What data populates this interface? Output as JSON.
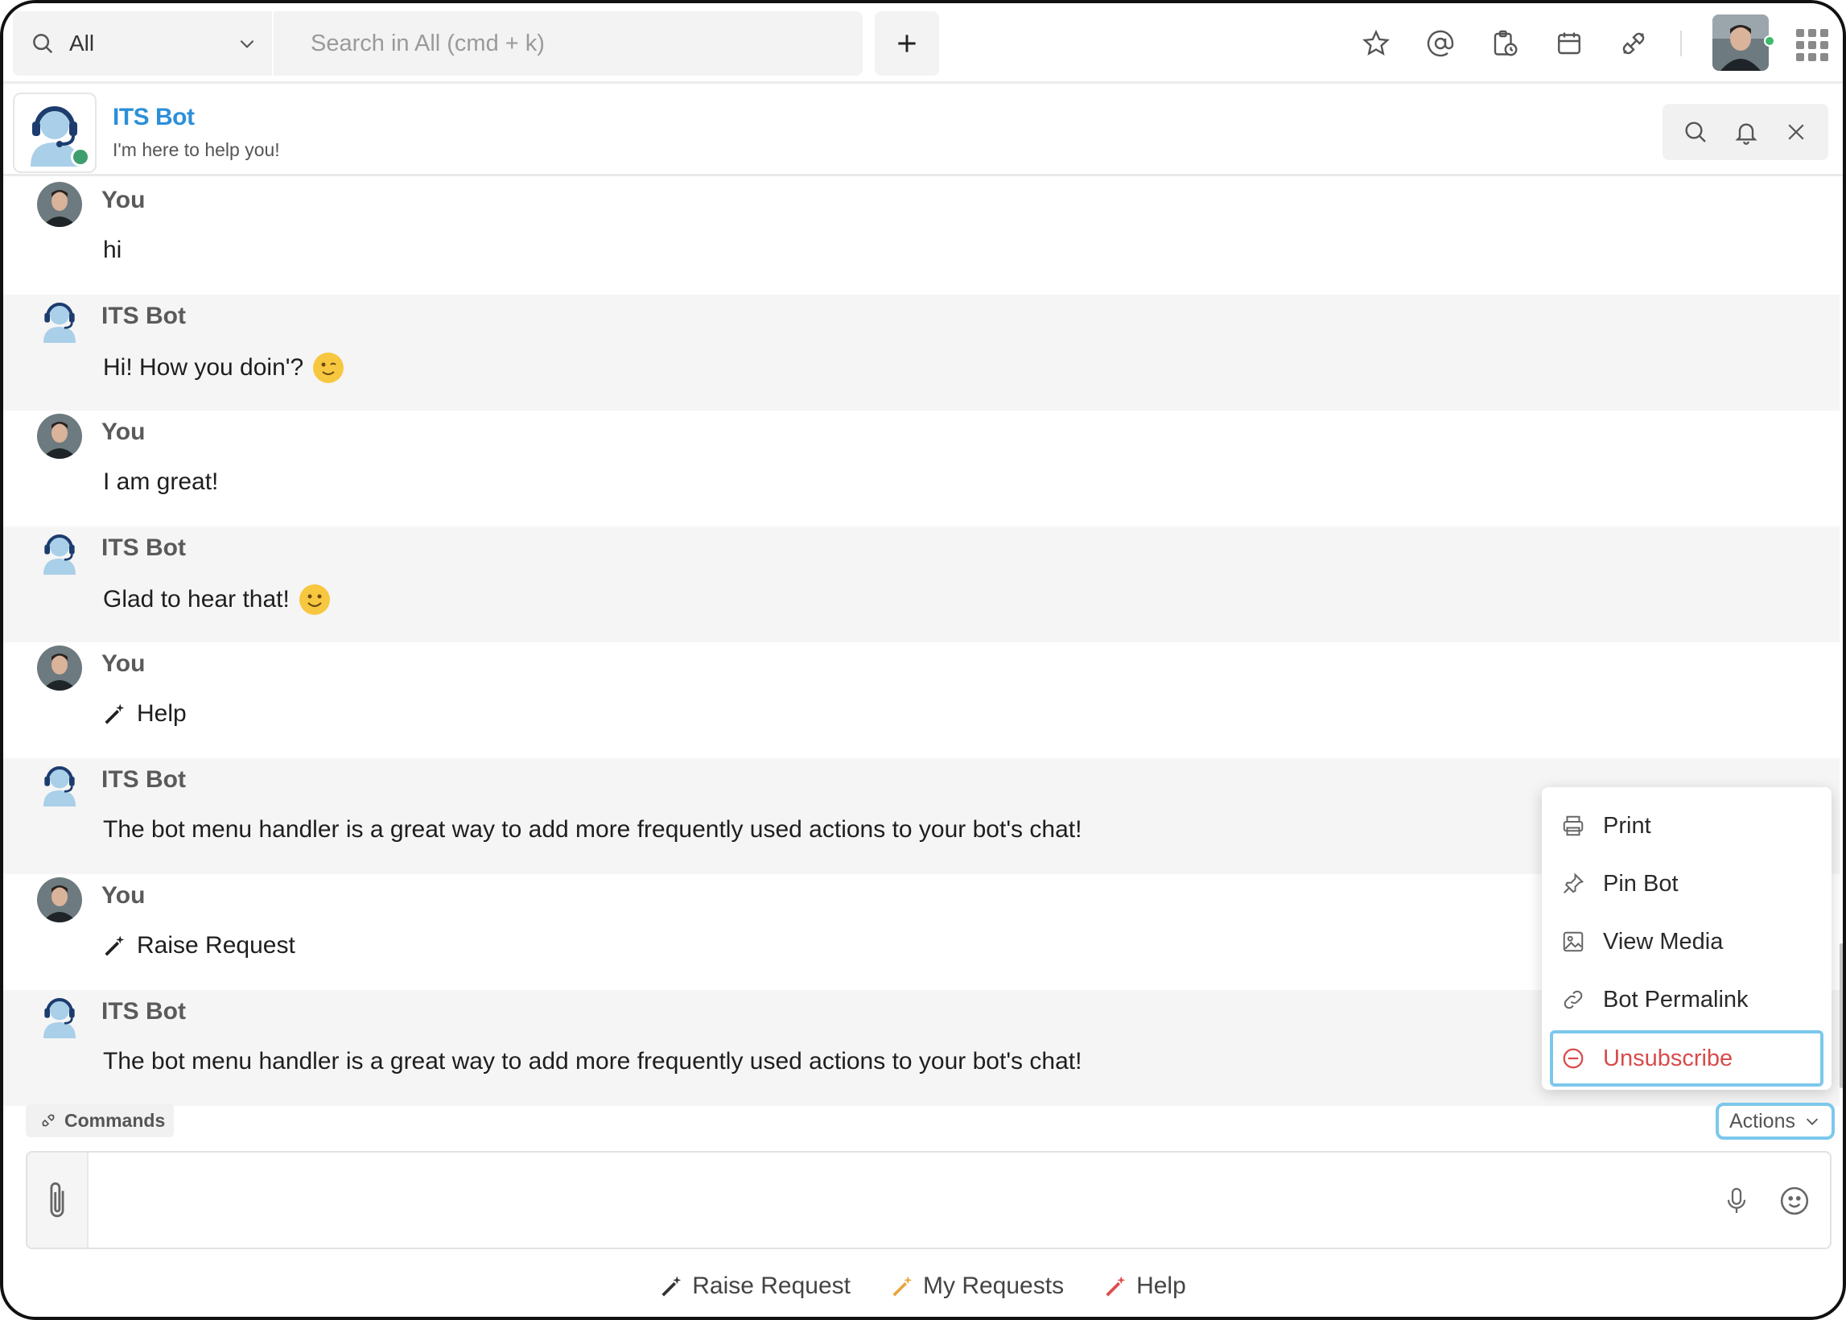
{
  "topbar": {
    "scope_label": "All",
    "search_placeholder": "Search in All (cmd + k)"
  },
  "chat_header": {
    "title": "ITS Bot",
    "subtitle": "I'm here to help you!"
  },
  "messages": [
    {
      "sender": "You",
      "text": "hi",
      "type": "user"
    },
    {
      "sender": "ITS Bot",
      "text": "Hi! How you doin'?",
      "type": "bot",
      "emoji": "winking-face"
    },
    {
      "sender": "You",
      "text": "I am great!",
      "type": "user"
    },
    {
      "sender": "ITS Bot",
      "text": "Glad to hear that!",
      "type": "bot",
      "emoji": "smiling-face"
    },
    {
      "sender": "You",
      "text": "Help",
      "type": "user",
      "icon": "magic-wand"
    },
    {
      "sender": "ITS Bot",
      "text": "The bot menu handler is a great way to add more frequently used actions to your bot's chat!",
      "type": "bot"
    },
    {
      "sender": "You",
      "text": "Raise Request",
      "type": "user",
      "icon": "magic-wand"
    },
    {
      "sender": "ITS Bot",
      "text": "The bot menu handler is a great way to add more frequently used actions to your bot's chat!",
      "type": "bot"
    }
  ],
  "actions_menu": {
    "items": [
      {
        "label": "Print",
        "icon": "printer-icon"
      },
      {
        "label": "Pin Bot",
        "icon": "pin-icon"
      },
      {
        "label": "View Media",
        "icon": "image-icon"
      },
      {
        "label": "Bot Permalink",
        "icon": "link-icon"
      },
      {
        "label": "Unsubscribe",
        "icon": "minus-circle-icon",
        "color": "#d84b4b"
      }
    ]
  },
  "composer": {
    "commands_label": "Commands",
    "actions_label": "Actions",
    "placeholder": ""
  },
  "quick_replies": [
    {
      "label": "Raise Request",
      "color": "#333333"
    },
    {
      "label": "My Requests",
      "color": "#e9a640"
    },
    {
      "label": "Help",
      "color": "#e04b4b"
    }
  ],
  "colors": {
    "accent": "#2d8fd9",
    "focus_ring": "#7cc8ec",
    "danger": "#d84b4b",
    "online": "#3dbb6b"
  }
}
